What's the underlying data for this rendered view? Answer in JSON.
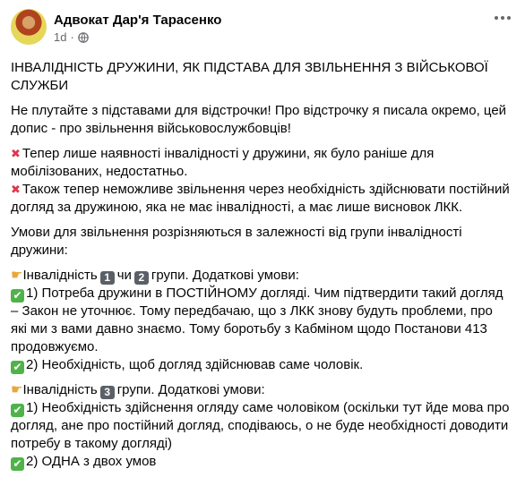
{
  "post": {
    "author": "Адвокат Дар'я Тарасенко",
    "time": "1d",
    "privacy_icon": "globe-icon",
    "more_icon": "more-options-icon"
  },
  "content": {
    "title": "ІНВАЛІДНІСТЬ ДРУЖИНИ, ЯК ПІДСТАВА ДЛЯ ЗВІЛЬНЕННЯ З ВІЙСЬКОВОЇ СЛУЖБИ",
    "intro": "Не плутайте з підставами для відстрочки! Про відстрочку я писала окремо, цей допис - про звільнення військовослужбовців!",
    "x_line_1": "Тепер лише наявності інвалідності у дружини, як було раніше для мобілізованих, недостатньо.",
    "x_line_2": "Також тепер неможливе звільнення через необхідність здійснювати постійний догляд за дружиною, яка не має інвалідності, а має лише висновок ЛКК.",
    "conditions_intro": "Умови для звільнення розрізняються в залежності від групи інвалідності дружини:",
    "group12_prefix": "Інвалідність",
    "group12_num1": "1",
    "group12_mid": "чи",
    "group12_num2": "2",
    "group12_suffix": "групи. Додаткові умови:",
    "group12_cond1": "1) Потреба дружини в ПОСТІЙНОМУ догляді. Чим підтвердити такий догляд – Закон не уточнює. Тому передбачаю, що з ЛКК знову будуть проблеми, про які ми з вами давно знаємо. Тому боротьбу з Кабміном щодо Постанови 413 продовжуємо.",
    "group12_cond2": "2) Необхідність, щоб догляд здійснював саме чоловік.",
    "group3_prefix": "Інвалідність",
    "group3_num": "3",
    "group3_suffix": "групи. Додаткові умови:",
    "group3_cond1": "1) Необхідність здійснення огляду саме чоловіком (оскільки тут йде мова про догляд,  ане про постійний догляд, сподіваюсь, о не буде необхідності доводити потребу в такому догляді)",
    "group3_cond2": "2) ОДНА з двох умов"
  }
}
